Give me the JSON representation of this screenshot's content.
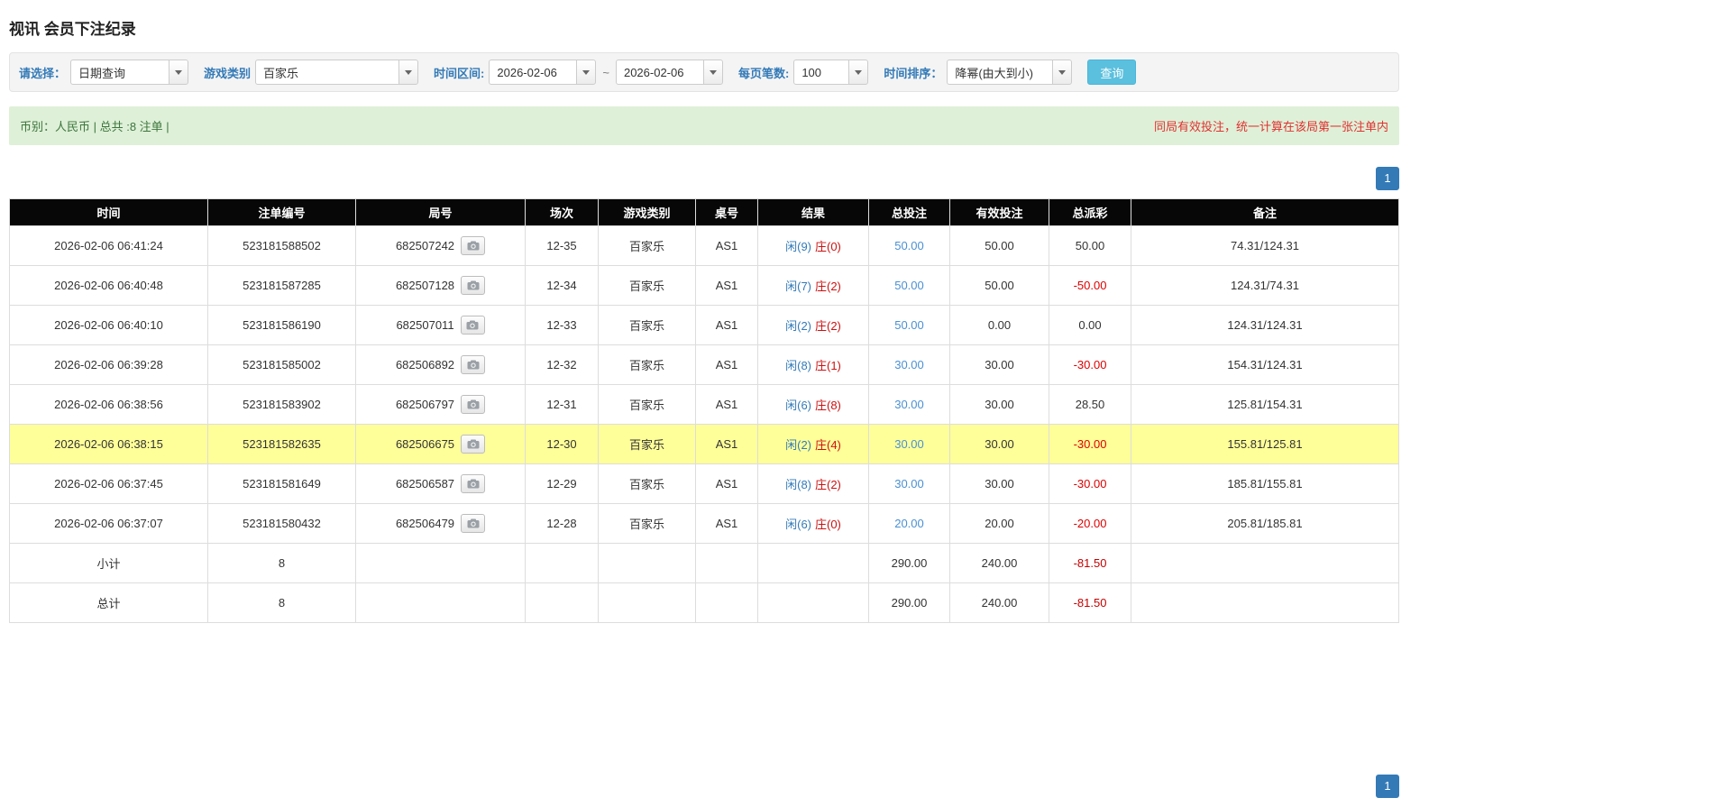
{
  "page": {
    "title": "视讯 会员下注纪录"
  },
  "colors": {
    "accent_blue": "#337ab7",
    "search_button_blue": "#5bc0de",
    "notice_bg_green": "#dff0d8",
    "notice_text_green": "#3c763d",
    "warning_red": "#e03131",
    "negative_red": "#dd0000",
    "highlight_row_yellow": "#ffff99",
    "table_header_bg": "#070707",
    "footer_row_gray": "#999999"
  },
  "filters": {
    "select_label": "请选择：",
    "select_value": "日期查询",
    "game_type_label": "游戏类别",
    "game_type_value": "百家乐",
    "date_range_label": "时间区间:",
    "date_from": "2026-02-06",
    "date_tilde": "~",
    "date_to": "2026-02-06",
    "page_size_label": "每页笔数:",
    "page_size_value": "100",
    "sort_label": "时间排序：",
    "sort_value": "降幂(由大到小)",
    "search_button": "查询"
  },
  "summary": {
    "left": "币别：人民币 | 总共 :8 注单 |",
    "right": "同局有效投注，统一计算在该局第一张注单内"
  },
  "pagination": {
    "page": "1"
  },
  "icons": {
    "replay": "camera-icon",
    "dropdown": "caret-down-icon"
  },
  "table": {
    "headers": [
      "时间",
      "注单编号",
      "局号",
      "场次",
      "游戏类别",
      "桌号",
      "结果",
      "总投注",
      "有效投注",
      "总派彩",
      "备注"
    ],
    "rows": [
      {
        "time": "2026-02-06 06:41:24",
        "bet_id": "523181588502",
        "round_id": "682507242",
        "session": "12-35",
        "game": "百家乐",
        "table_no": "AS1",
        "result_player": "闲(9)",
        "result_banker": "庄(0)",
        "total_bet": "50.00",
        "valid_bet": "50.00",
        "payout": "50.00",
        "note": "74.31/124.31",
        "highlighted": false
      },
      {
        "time": "2026-02-06 06:40:48",
        "bet_id": "523181587285",
        "round_id": "682507128",
        "session": "12-34",
        "game": "百家乐",
        "table_no": "AS1",
        "result_player": "闲(7)",
        "result_banker": "庄(2)",
        "total_bet": "50.00",
        "valid_bet": "50.00",
        "payout": "-50.00",
        "note": "124.31/74.31",
        "highlighted": false
      },
      {
        "time": "2026-02-06 06:40:10",
        "bet_id": "523181586190",
        "round_id": "682507011",
        "session": "12-33",
        "game": "百家乐",
        "table_no": "AS1",
        "result_player": "闲(2)",
        "result_banker": "庄(2)",
        "total_bet": "50.00",
        "valid_bet": "0.00",
        "payout": "0.00",
        "note": "124.31/124.31",
        "highlighted": false
      },
      {
        "time": "2026-02-06 06:39:28",
        "bet_id": "523181585002",
        "round_id": "682506892",
        "session": "12-32",
        "game": "百家乐",
        "table_no": "AS1",
        "result_player": "闲(8)",
        "result_banker": "庄(1)",
        "total_bet": "30.00",
        "valid_bet": "30.00",
        "payout": "-30.00",
        "note": "154.31/124.31",
        "highlighted": false
      },
      {
        "time": "2026-02-06 06:38:56",
        "bet_id": "523181583902",
        "round_id": "682506797",
        "session": "12-31",
        "game": "百家乐",
        "table_no": "AS1",
        "result_player": "闲(6)",
        "result_banker": "庄(8)",
        "total_bet": "30.00",
        "valid_bet": "30.00",
        "payout": "28.50",
        "note": "125.81/154.31",
        "highlighted": false
      },
      {
        "time": "2026-02-06 06:38:15",
        "bet_id": "523181582635",
        "round_id": "682506675",
        "session": "12-30",
        "game": "百家乐",
        "table_no": "AS1",
        "result_player": "闲(2)",
        "result_banker": "庄(4)",
        "total_bet": "30.00",
        "valid_bet": "30.00",
        "payout": "-30.00",
        "note": "155.81/125.81",
        "highlighted": true
      },
      {
        "time": "2026-02-06 06:37:45",
        "bet_id": "523181581649",
        "round_id": "682506587",
        "session": "12-29",
        "game": "百家乐",
        "table_no": "AS1",
        "result_player": "闲(8)",
        "result_banker": "庄(2)",
        "total_bet": "30.00",
        "valid_bet": "30.00",
        "payout": "-30.00",
        "note": "185.81/155.81",
        "highlighted": false
      },
      {
        "time": "2026-02-06 06:37:07",
        "bet_id": "523181580432",
        "round_id": "682506479",
        "session": "12-28",
        "game": "百家乐",
        "table_no": "AS1",
        "result_player": "闲(6)",
        "result_banker": "庄(0)",
        "total_bet": "20.00",
        "valid_bet": "20.00",
        "payout": "-20.00",
        "note": "205.81/185.81",
        "highlighted": false
      }
    ],
    "subtotal": {
      "label": "小计",
      "count": "8",
      "total_bet": "290.00",
      "valid_bet": "240.00",
      "payout": "-81.50"
    },
    "total": {
      "label": "总计",
      "count": "8",
      "total_bet": "290.00",
      "valid_bet": "240.00",
      "payout": "-81.50"
    }
  }
}
